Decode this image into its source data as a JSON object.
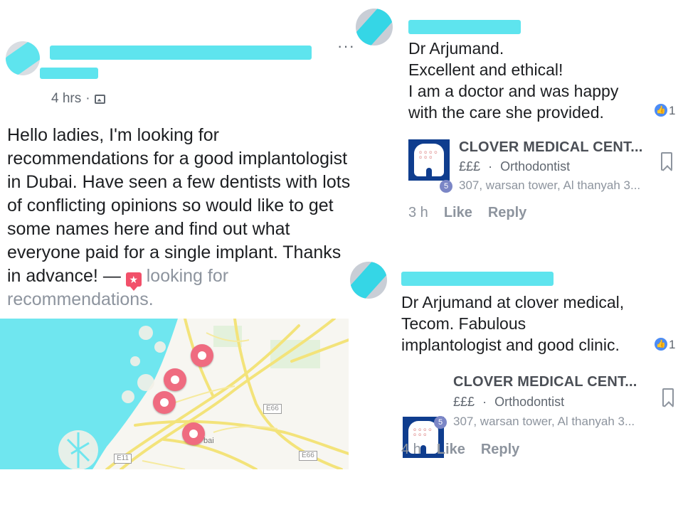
{
  "post": {
    "time": "4 hrs",
    "separator": "·",
    "body": "Hello ladies, I'm looking for recommendations for a good implantologist in Dubai. Have seen a few dentists with lots of conflicting opinions so would like to get some names here and find out what everyone paid for a single implant. Thanks in advance! —",
    "tag_text": "looking for recommendations.",
    "more": "···"
  },
  "map": {
    "place_label": "bai",
    "road_labels": [
      "E66",
      "E11",
      "E66"
    ]
  },
  "comments": [
    {
      "text_lines": [
        "Dr Arjumand.",
        "Excellent and ethical!",
        "I am a doctor and was happy",
        "with the care she provided."
      ],
      "like_count": "1",
      "card": {
        "title": "CLOVER MEDICAL CENT...",
        "price": "£££",
        "dot": "·",
        "category": "Orthodontist",
        "address": "307, warsan tower, Al thanyah 3...",
        "badge": "5"
      },
      "time": "3 h",
      "like_label": "Like",
      "reply_label": "Reply"
    },
    {
      "text_lines": [
        "Dr Arjumand at clover medical,",
        "Tecom.  Fabulous",
        "implantologist and good clinic."
      ],
      "like_count": "1",
      "card": {
        "title": "CLOVER MEDICAL CENT...",
        "price": "£££",
        "dot": "·",
        "category": "Orthodontist",
        "address": "307, warsan tower, Al thanyah 3...",
        "badge": "5"
      },
      "time": "4 h",
      "like_label": "Like",
      "reply_label": "Reply"
    }
  ],
  "colors": {
    "redaction": "#5ee4ee",
    "pin": "#ef6b80",
    "like_blue": "#4c8cf5",
    "water": "#6fe6ef"
  }
}
